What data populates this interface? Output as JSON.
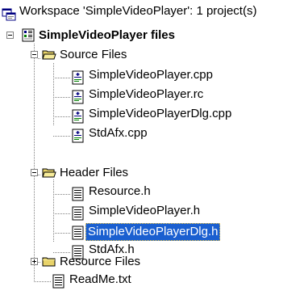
{
  "workspace": {
    "title": "Workspace 'SimpleVideoPlayer': 1 project(s)",
    "icon": "workspace-icon"
  },
  "project": {
    "label": "SimpleVideoPlayer files",
    "icon": "project-icon",
    "expanded": true
  },
  "folders": [
    {
      "label": "Source Files",
      "icon": "folder-open-icon",
      "expanded": true,
      "files": [
        {
          "label": "SimpleVideoPlayer.cpp",
          "icon": "cpp-file-icon"
        },
        {
          "label": "SimpleVideoPlayer.rc",
          "icon": "rc-file-icon"
        },
        {
          "label": "SimpleVideoPlayerDlg.cpp",
          "icon": "cpp-file-icon"
        },
        {
          "label": "StdAfx.cpp",
          "icon": "cpp-file-icon"
        }
      ]
    },
    {
      "label": "Header Files",
      "icon": "folder-open-icon",
      "expanded": true,
      "files": [
        {
          "label": "Resource.h",
          "icon": "header-file-icon"
        },
        {
          "label": "SimpleVideoPlayer.h",
          "icon": "header-file-icon"
        },
        {
          "label": "SimpleVideoPlayerDlg.h",
          "icon": "header-file-icon",
          "selected": true
        },
        {
          "label": "StdAfx.h",
          "icon": "header-file-icon"
        }
      ]
    },
    {
      "label": "Resource Files",
      "icon": "folder-closed-icon",
      "expanded": false,
      "files": []
    }
  ],
  "root_files": [
    {
      "label": "ReadMe.txt",
      "icon": "text-file-icon"
    }
  ],
  "colors": {
    "selection": "#1a5fd0",
    "tree_lines": "#808080",
    "folder": "#e8d36a"
  }
}
